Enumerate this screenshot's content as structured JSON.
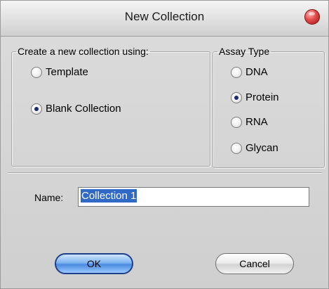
{
  "window": {
    "title": "New Collection"
  },
  "create": {
    "legend": "Create a new collection using:",
    "options": [
      {
        "label": "Template",
        "checked": false
      },
      {
        "label": "Blank Collection",
        "checked": true
      }
    ]
  },
  "assay": {
    "legend": "Assay Type",
    "options": [
      {
        "label": "DNA",
        "checked": false
      },
      {
        "label": "Protein",
        "checked": true
      },
      {
        "label": "RNA",
        "checked": false
      },
      {
        "label": "Glycan",
        "checked": false
      }
    ]
  },
  "name": {
    "label": "Name:",
    "value": "Collection 1"
  },
  "buttons": {
    "ok": "OK",
    "cancel": "Cancel"
  },
  "colors": {
    "selection": "#3169c6",
    "close_button": "#e24a4a",
    "default_button": "#4a8be0"
  }
}
